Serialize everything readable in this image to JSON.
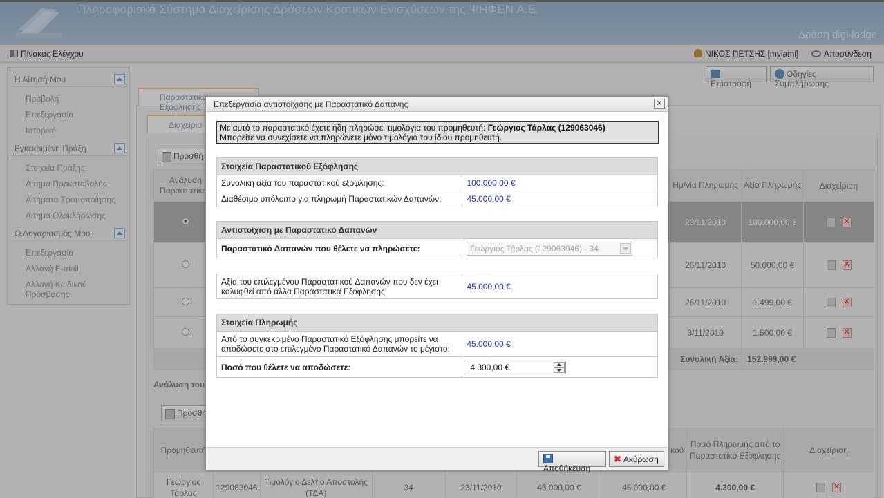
{
  "header": {
    "title": "Πληροφοριακό Σύστημα Διαχείρισης Δράσεων Κρατικών Ενισχύσεων της ΨΗΦΕΝ Α.Ε.",
    "action": "Δράση digi-lodge"
  },
  "topbar": {
    "dashboard": "Πίνακας Ελέγχου",
    "user": "ΝΙΚΟΣ ΠΕΤΣΗΣ [mvlami]",
    "logout": "Αποσύνδεση"
  },
  "sidebar": {
    "sections": [
      {
        "title": "Η Αίτησή Μου",
        "items": [
          "Προβολή",
          "Επεξεργασία",
          "Ιστορικό"
        ]
      },
      {
        "title": "Εγκεκριμένη Πράξη",
        "items": [
          "Στοιχεία Πράξης",
          "Αίτημα Προκαταβολής",
          "Αιτήματα Τροποποίησης",
          "Αίτημα Ολοκλήρωσης"
        ]
      },
      {
        "title": "Ο Λογαριασμός Μου",
        "items": [
          "Επεξεργασία",
          "Αλλαγή E-mail",
          "Αλλαγή Κωδικού Πρόσβασης"
        ]
      }
    ]
  },
  "toolbar": {
    "back": "Επιστροφή",
    "help": "Οδηγίες Συμπλήρωσης"
  },
  "background": {
    "outer_tab": "Παραστατικά Εξόφλησης",
    "inner_tab": "Διαχείρισ",
    "add_label_1": "Προσθή",
    "add_label_2": "Προσθή",
    "analysis_label": "Ανάλυση του",
    "table1": {
      "headers": [
        "Ανάλυση Παραστατικού",
        "Ημ/νία Πληρωμής",
        "Αξία Πληρωμής",
        "Διαχείριση"
      ],
      "rows": [
        {
          "date": "23/11/2010",
          "value": "100.000,00 €",
          "selected": true
        },
        {
          "date": "26/11/2010",
          "value": "50.000,00 €",
          "selected": false
        },
        {
          "date": "26/11/2010",
          "value": "1.499,00 €",
          "selected": false
        },
        {
          "date": "3/11/2010",
          "value": "1.500,00 €",
          "selected": false
        }
      ],
      "total_label": "Συνολική Αξία:",
      "total_value": "152.999,00 €"
    },
    "table2": {
      "headers": [
        "Προμηθευτή",
        "κού",
        "Ποσό Πληρωμής από το Παραστατικό Εξόφλησης",
        "Διαχείριση"
      ],
      "row": {
        "supplier": "Γεώργιος Τάρλας",
        "afm": "129063046",
        "doc_type": "Τιμολόγιο Δελτίο Αποστολής (ΤΔΑ)",
        "number": "34",
        "date": "23/11/2010",
        "value1": "45.000,00 €",
        "value2": "45.000,00 €",
        "amount": "4.300,00 €"
      }
    }
  },
  "dialog": {
    "title": "Επεξεργασία αντιστοίχισης με Παραστατικό Δαπάνης",
    "close": "✕",
    "notice_line1_prefix": "Με αυτό το παραστατικό έχετε ήδη πληρώσει τιμολόγια του προμηθευτή: ",
    "notice_line1_bold": "Γεώργιος Τάρλας (129063046)",
    "notice_line2": "Μπορείτε να συνεχίσετε να πληρώνετε μόνο τιμολόγια του ίδιου προμηθευτή.",
    "section1": {
      "header": "Στοιχεία Παραστατικού Εξόφλησης",
      "rows": [
        {
          "label": "Συνολική αξία του παραστατικού εξόφλησης:",
          "value": "100.000,00 €"
        },
        {
          "label": "Διαθέσιμο υπόλοιπο για πληρωμή Παραστατικών Δαπανών:",
          "value": "45.000,00 €"
        }
      ]
    },
    "section2": {
      "header": "Αντιστοίχιση με Παραστατικό Δαπανών",
      "select_label": "Παραστατικό Δαπανών που θέλετε να πληρώσετε:",
      "select_value": "Γεώργιος Τάρλας (129063046) - 34",
      "uncovered_label": "Αξία του επιλεγμένου Παραστατικού Δαπανών που δεν έχει καλυφθεί από άλλα Παραστατικά Εξόφλησης:",
      "uncovered_value": "45.000,00 €"
    },
    "section3": {
      "header": "Στοιχεία Πληρωμής",
      "max_label": "Από το συγκεκριμένο Παραστατικό Εξόφλησης μπορείτε να αποδώσετε στο επιλεγμένο Παραστατικό Δαπανών το μέγιστο:",
      "max_value": "45.000,00 €",
      "amount_label": "Ποσό που θέλετε να αποδώσετε:",
      "amount_value": "4.300,00 €"
    },
    "save": "Αποθήκευση",
    "cancel": "Ακύρωση"
  }
}
